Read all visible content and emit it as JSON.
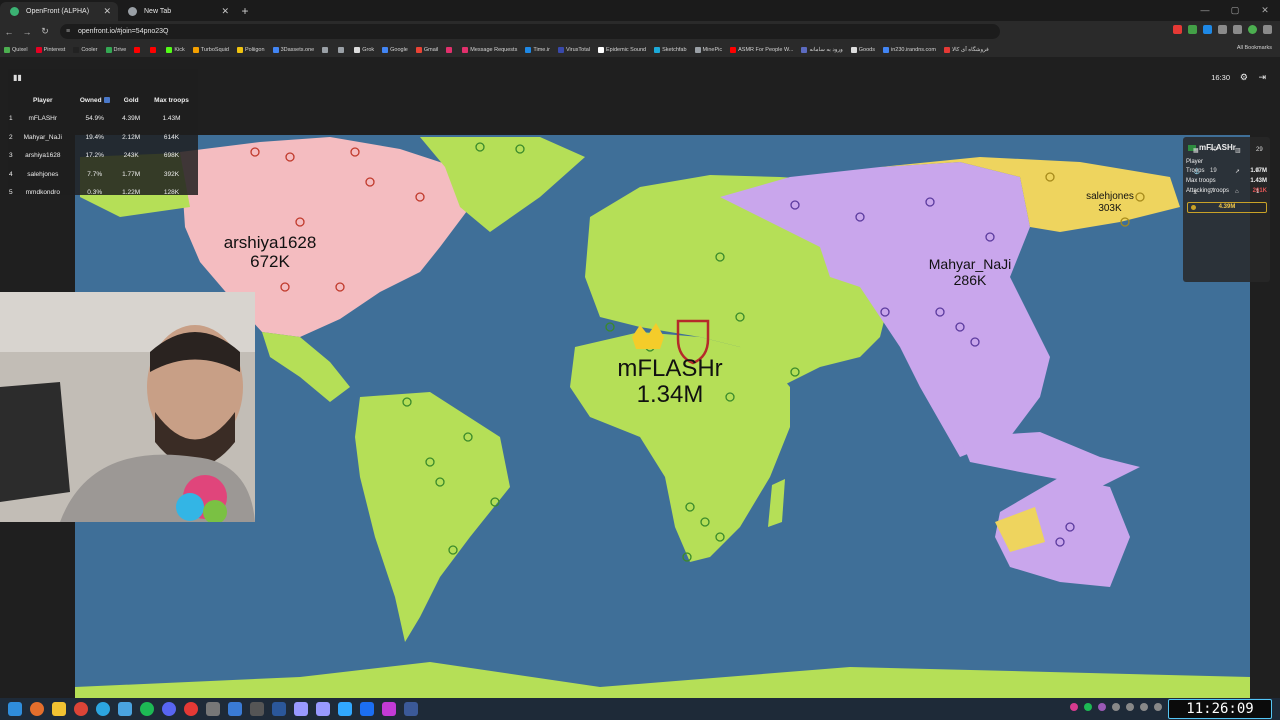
{
  "browser": {
    "tabs": [
      {
        "title": "OpenFront (ALPHA)",
        "active": true,
        "favicon_color": "#3bb273"
      },
      {
        "title": "New Tab",
        "active": false,
        "favicon_color": "#9aa0a6"
      }
    ],
    "url": "openfront.io/#join=54pno23Q",
    "bookmarks": [
      {
        "label": "Quixel",
        "color": "#4caf50"
      },
      {
        "label": "Pinterest",
        "color": "#e60023"
      },
      {
        "label": "Cooler",
        "color": "#222222"
      },
      {
        "label": "Drive",
        "color": "#34a853"
      },
      {
        "label": "",
        "color": "#ff0000"
      },
      {
        "label": "",
        "color": "#ff0000"
      },
      {
        "label": "Kick",
        "color": "#53fc18"
      },
      {
        "label": "TurboSquid",
        "color": "#f4a000"
      },
      {
        "label": "Poliigon",
        "color": "#f1c40f"
      },
      {
        "label": "3Dassets.one",
        "color": "#4285f4"
      },
      {
        "label": "",
        "color": "#9aa0a6"
      },
      {
        "label": "",
        "color": "#9aa0a6"
      },
      {
        "label": "Grok",
        "color": "#dddddd"
      },
      {
        "label": "Google",
        "color": "#4285f4"
      },
      {
        "label": "Gmail",
        "color": "#ea4335"
      },
      {
        "label": "",
        "color": "#e1306c"
      },
      {
        "label": "Message Requests",
        "color": "#e1306c"
      },
      {
        "label": "Time.ir",
        "color": "#1e88e5"
      },
      {
        "label": "VirusTotal",
        "color": "#3949ab"
      },
      {
        "label": "Epidemic Sound",
        "color": "#ffffff"
      },
      {
        "label": "Sketchfab",
        "color": "#1caad9"
      },
      {
        "label": "MinePic",
        "color": "#9aa0a6"
      },
      {
        "label": "ASMR For People W...",
        "color": "#ff0000"
      },
      {
        "label": "ورود به سامانه",
        "color": "#5c6bc0"
      },
      {
        "label": "Goods",
        "color": "#dddddd"
      },
      {
        "label": "in230.irandns.com",
        "color": "#4285f4"
      },
      {
        "label": "فروشگاه آی کالا",
        "color": "#e53935"
      }
    ],
    "all_bookmarks": "All Bookmarks"
  },
  "game": {
    "clock": "16:30",
    "leaderboard": {
      "headers": {
        "rank": "",
        "player": "Player",
        "owned": "Owned",
        "gold": "Gold",
        "troops": "Max troops"
      },
      "rows": [
        {
          "rank": "1",
          "player": "mFLASHr",
          "owned": "54.9%",
          "gold": "4.39M",
          "troops": "1.43M"
        },
        {
          "rank": "2",
          "player": "Mahyar_NaJi",
          "owned": "19.4%",
          "gold": "2.12M",
          "troops": "614K"
        },
        {
          "rank": "3",
          "player": "arshiya1628",
          "owned": "17.2%",
          "gold": "243K",
          "troops": "698K"
        },
        {
          "rank": "4",
          "player": "salehjones",
          "owned": "7.7%",
          "gold": "1.77M",
          "troops": "392K"
        },
        {
          "rank": "5",
          "player": "mmdkondro",
          "owned": "0.3%",
          "gold": "1.22M",
          "troops": "128K"
        }
      ]
    },
    "player_info": {
      "name": "mFLASHr",
      "role": "Player",
      "troops_label": "Troops",
      "troops": "1.07M",
      "max_troops_label": "Max troops",
      "max_troops": "1.43M",
      "attacking_label": "Attacking troops",
      "attacking": "261K",
      "gold": "4.39M",
      "stats": [
        {
          "icon": "city-icon",
          "value": "40"
        },
        {
          "icon": "factory-icon",
          "value": "29"
        },
        {
          "icon": "port-icon",
          "value": "19"
        },
        {
          "icon": "missile-icon",
          "value": "4"
        },
        {
          "icon": "sam-icon",
          "value": "7"
        },
        {
          "icon": "warship-icon",
          "value": "1"
        }
      ]
    },
    "map_labels": [
      {
        "name": "mFLASHr",
        "troops": "1.34M",
        "size": "big"
      },
      {
        "name": "arshiya1628",
        "troops": "672K",
        "size": "mid"
      },
      {
        "name": "Mahyar_NaJi",
        "troops": "286K",
        "size": "mid"
      },
      {
        "name": "salehjones",
        "troops": "303K",
        "size": "small"
      }
    ],
    "territory_colors": {
      "mFLASHr": "#b5df57",
      "arshiya1628": "#f4bcc0",
      "Mahyar_NaJi": "#c9a6ec",
      "salehjones": "#eed45e",
      "ocean": "#3f6f98"
    }
  },
  "taskbar": {
    "time": "11:26:09"
  }
}
